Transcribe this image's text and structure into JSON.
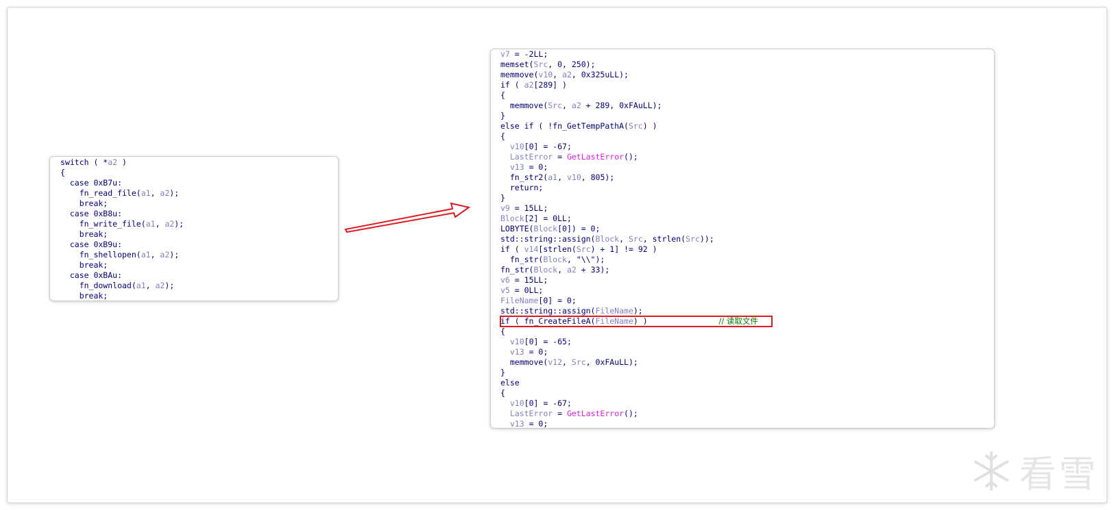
{
  "left_panel": {
    "lines": [
      "switch ( *a2 )",
      "{",
      "  case 0xB7u:",
      "    fn_read_file(a1, a2);",
      "    break;",
      "  case 0xB8u:",
      "    fn_write_file(a1, a2);",
      "    break;",
      "  case 0xB9u:",
      "    fn_shellopen(a1, a2);",
      "    break;",
      "  case 0xBAu:",
      "    fn_download(a1, a2);",
      "    break;"
    ]
  },
  "right_panel": {
    "lines": [
      "v7 = -2LL;",
      "memset(Src, 0, 250);",
      "memmove(v10, a2, 0x325uLL);",
      "if ( a2[289] )",
      "{",
      "  memmove(Src, a2 + 289, 0xFAuLL);",
      "}",
      "else if ( !fn_GetTempPathA(Src) )",
      "{",
      "  v10[0] = -67;",
      "  LastError = GetLastError();",
      "  v13 = 0;",
      "  fn_str2(a1, v10, 805);",
      "  return;",
      "}",
      "v9 = 15LL;",
      "Block[2] = 0LL;",
      "LOBYTE(Block[0]) = 0;",
      "std::string::assign(Block, Src, strlen(Src));",
      "if ( v14[strlen(Src) + 1] != 92 )",
      "  fn_str(Block, \"\\\\\");",
      "fn_str(Block, a2 + 33);",
      "v6 = 15LL;",
      "v5 = 0LL;",
      "FileName[0] = 0;",
      "std::string::assign(FileName);",
      "if ( fn_CreateFileA(FileName) )               // 读取文件",
      "{",
      "  v10[0] = -65;",
      "  v13 = 0;",
      "  memmove(v12, Src, 0xFAuLL);",
      "}",
      "else",
      "{",
      "  v10[0] = -67;",
      "  LastError = GetLastError();",
      "  v13 = 0;"
    ],
    "highlight_comment": "// 读取文件"
  },
  "watermark": {
    "text": "看雪",
    "icon": "snowflake-icon"
  },
  "colors": {
    "code_text": "#000080",
    "variable": "#8080c0",
    "import_fn": "#e020e0",
    "comment": "#008000",
    "highlight_box": "#e0191e",
    "arrow": "#e0191e"
  }
}
